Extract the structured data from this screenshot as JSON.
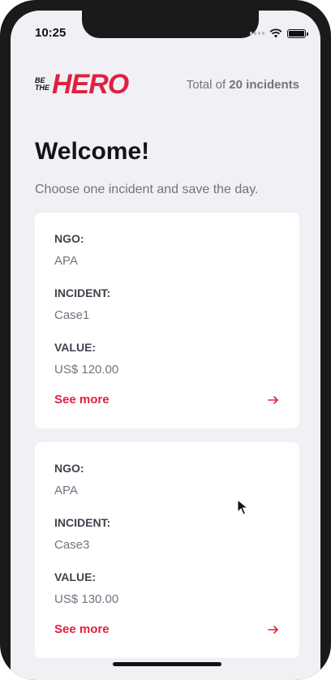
{
  "status_bar": {
    "time": "10:25"
  },
  "header": {
    "logo_small_line1": "BE",
    "logo_small_line2": "THE",
    "logo_big": "HERO",
    "total_prefix": "Total of",
    "total_count": "20 incidents"
  },
  "welcome": {
    "title": "Welcome!",
    "subtitle": "Choose one incident and save the day."
  },
  "labels": {
    "ngo": "NGO:",
    "incident": "INCIDENT:",
    "value": "VALUE:",
    "see_more": "See more"
  },
  "incidents": [
    {
      "ngo": "APA",
      "incident": "Case1",
      "value": "US$ 120.00"
    },
    {
      "ngo": "APA",
      "incident": "Case3",
      "value": "US$ 130.00"
    }
  ],
  "colors": {
    "brand": "#e02041",
    "background": "#f0f0f5",
    "text_dark": "#13131a",
    "text_muted": "#737380"
  },
  "icons": [
    "wifi-icon",
    "battery-icon",
    "arrow-right-icon",
    "cursor-icon"
  ]
}
